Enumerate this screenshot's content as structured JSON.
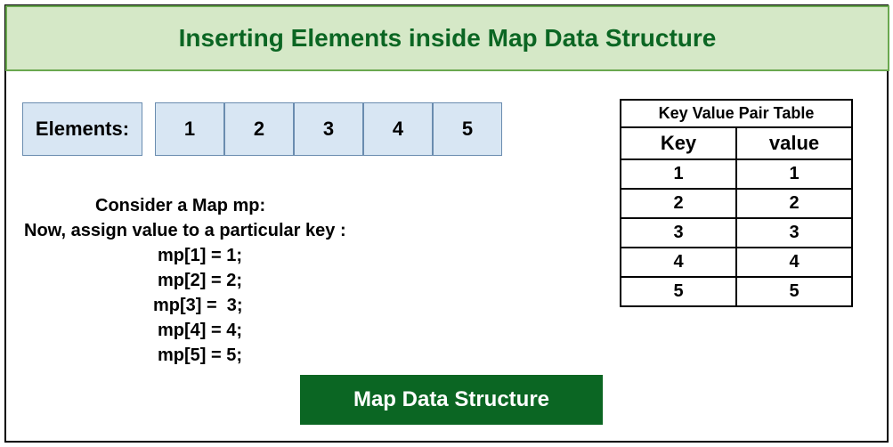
{
  "title": "Inserting Elements inside Map Data Structure",
  "elements_label": "Elements:",
  "elements": [
    "1",
    "2",
    "3",
    "4",
    "5"
  ],
  "code": {
    "line1": "Consider a Map mp:",
    "line2": "Now, assign value to a particular key :",
    "assign1": "mp[1] = 1;",
    "assign2": "mp[2] = 2;",
    "assign3": "mp[3] =  3;",
    "assign4": "mp[4] = 4;",
    "assign5": "mp[5] = 5;"
  },
  "table": {
    "caption": "Key Value Pair Table",
    "header_key": "Key",
    "header_value": "value",
    "rows": [
      {
        "k": "1",
        "v": "1"
      },
      {
        "k": "2",
        "v": "2"
      },
      {
        "k": "3",
        "v": "3"
      },
      {
        "k": "4",
        "v": "4"
      },
      {
        "k": "5",
        "v": "5"
      }
    ]
  },
  "footer": "Map Data Structure"
}
